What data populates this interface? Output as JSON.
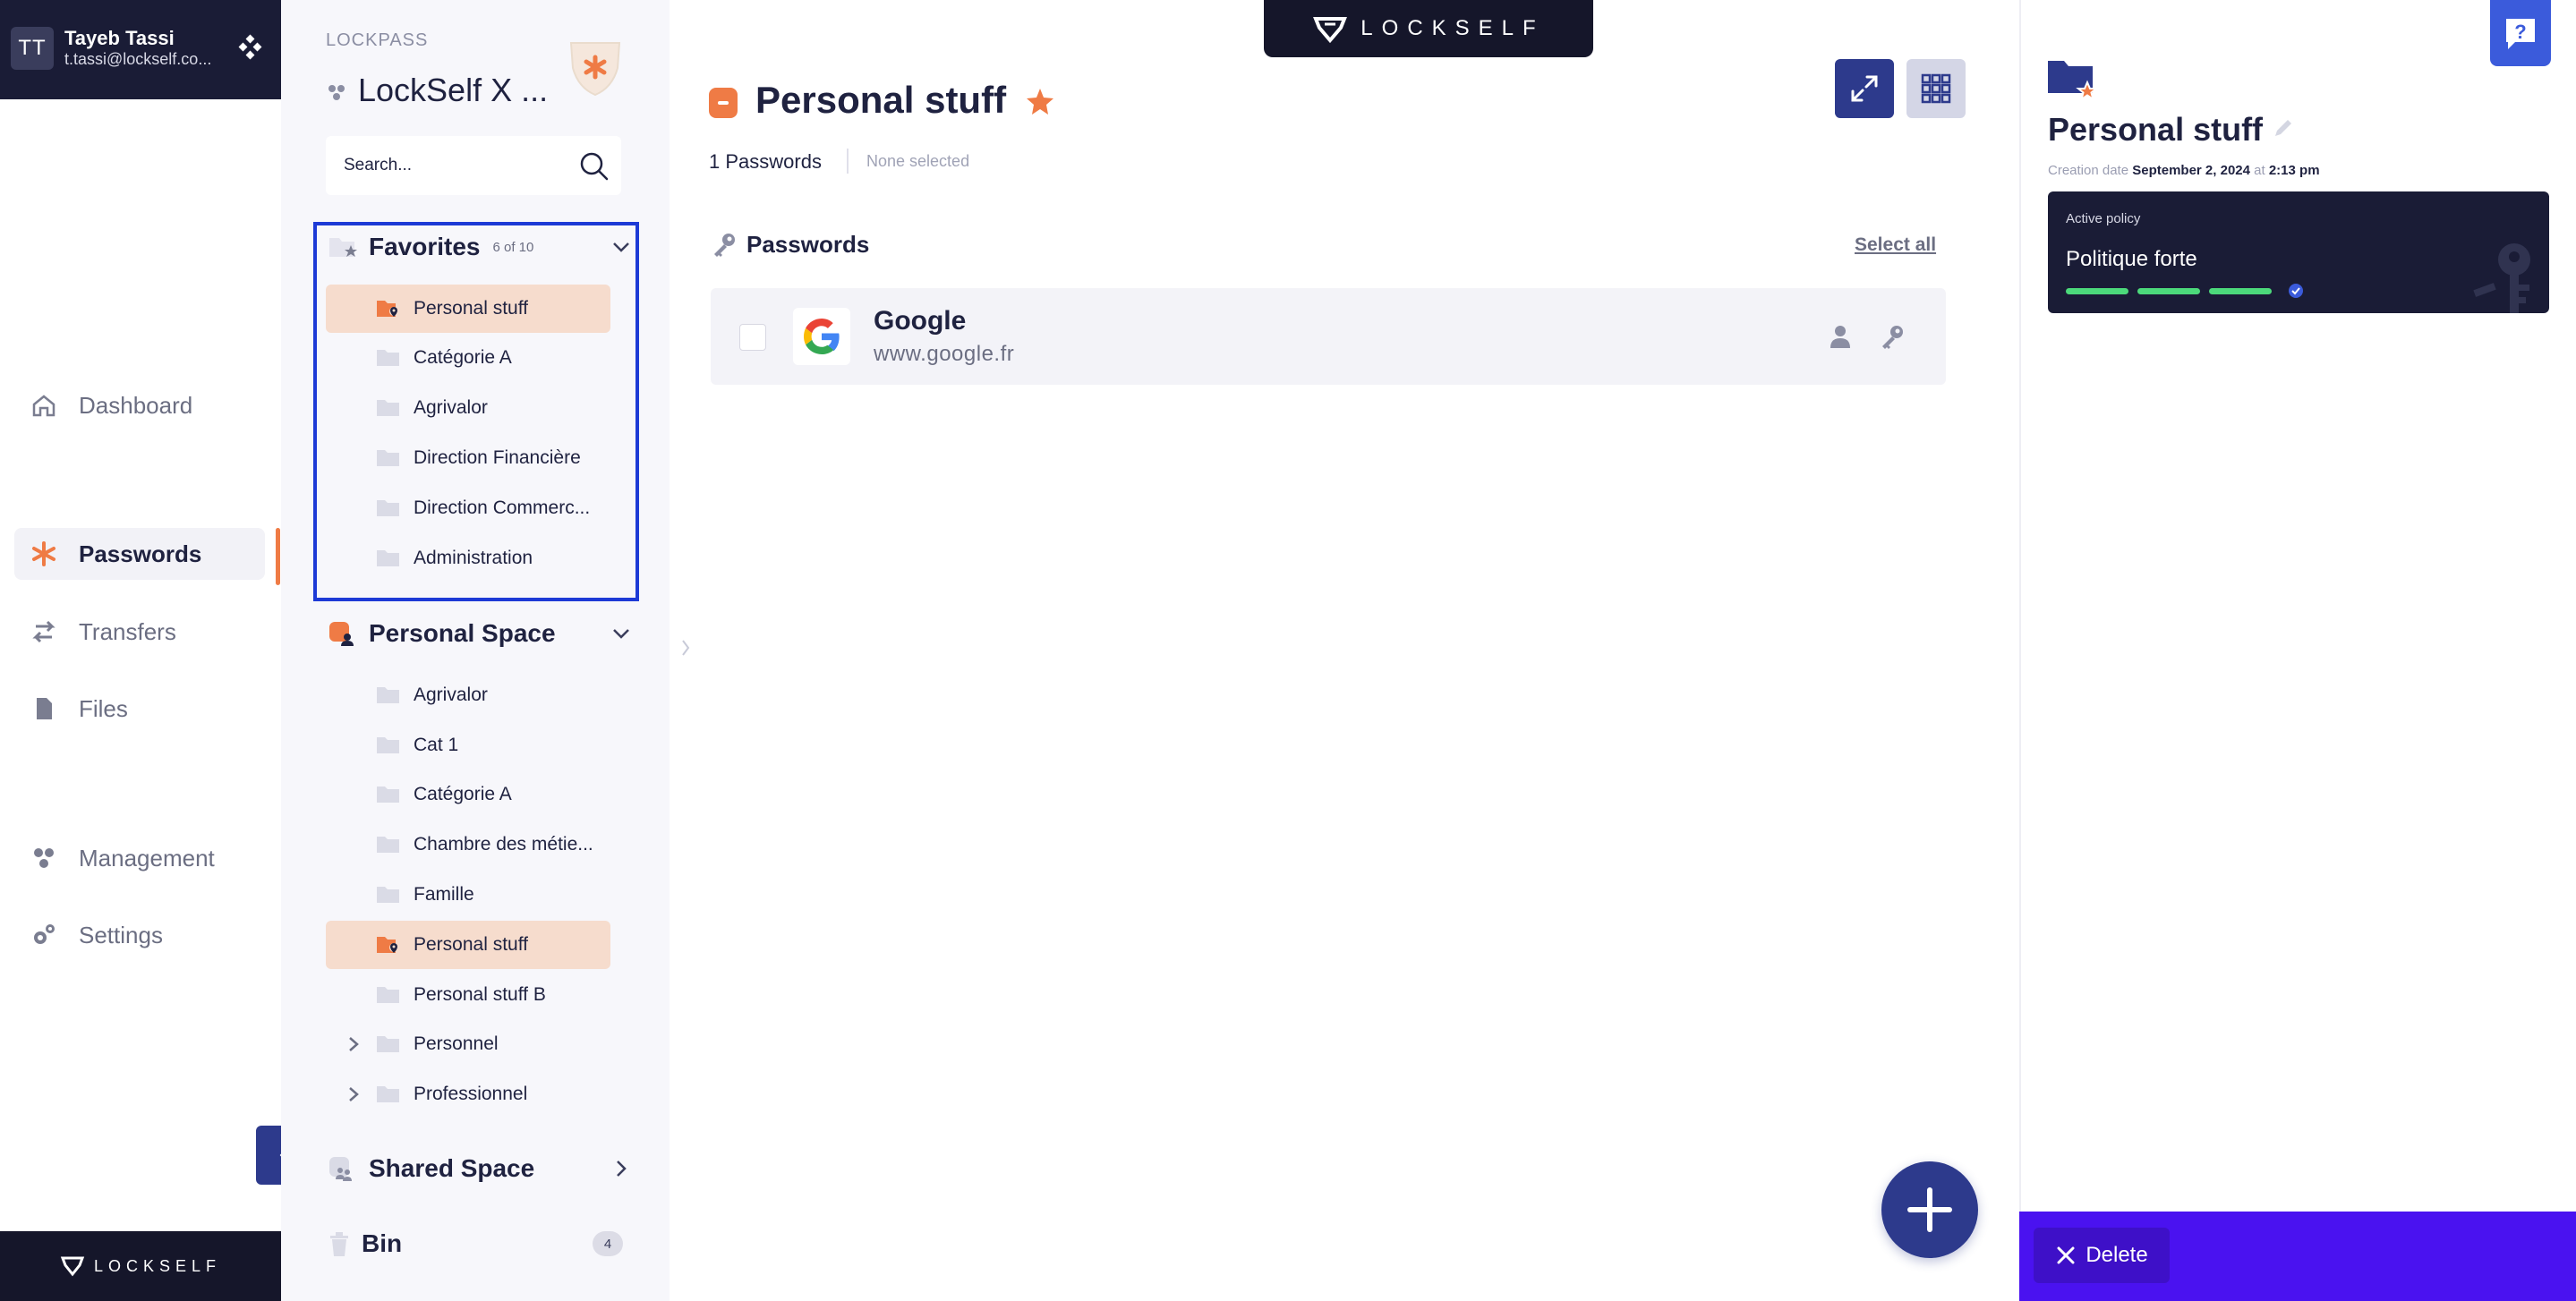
{
  "user": {
    "initials": "TT",
    "name": "Tayeb Tassi",
    "email": "t.tassi@lockself.co..."
  },
  "brand": {
    "wordmark": "LOCKSELF"
  },
  "nav": {
    "items": [
      {
        "label": "Dashboard",
        "icon": "home-icon"
      },
      {
        "label": "Passwords",
        "icon": "asterisk-icon",
        "active": true
      },
      {
        "label": "Transfers",
        "icon": "transfer-icon"
      },
      {
        "label": "Files",
        "icon": "file-icon"
      },
      {
        "label": "Management",
        "icon": "management-icon"
      },
      {
        "label": "Settings",
        "icon": "gear-icon"
      }
    ]
  },
  "folder_panel": {
    "caption": "LOCKPASS",
    "workspace_title": "LockSelf X ...",
    "search_placeholder": "Search...",
    "favorites": {
      "title": "Favorites",
      "count": "6 of 10",
      "items": [
        {
          "label": "Personal stuff",
          "active": true
        },
        {
          "label": "Catégorie A"
        },
        {
          "label": "Agrivalor"
        },
        {
          "label": "Direction Financière"
        },
        {
          "label": "Direction Commerc..."
        },
        {
          "label": "Administration"
        }
      ]
    },
    "personal_space": {
      "title": "Personal Space",
      "items": [
        {
          "label": "Agrivalor"
        },
        {
          "label": "Cat 1"
        },
        {
          "label": "Catégorie A"
        },
        {
          "label": "Chambre des métie..."
        },
        {
          "label": "Famille"
        },
        {
          "label": "Personal stuff",
          "active": true
        },
        {
          "label": "Personal stuff B"
        },
        {
          "label": "Personnel",
          "expandable": true
        },
        {
          "label": "Professionnel",
          "expandable": true
        }
      ]
    },
    "shared_space": {
      "title": "Shared Space"
    },
    "bin": {
      "title": "Bin",
      "count": "4"
    }
  },
  "main": {
    "title": "Personal stuff",
    "pw_count": "1 Passwords",
    "selection": "None selected",
    "section_title": "Passwords",
    "select_all": "Select all",
    "entries": [
      {
        "name": "Google",
        "url": "www.google.fr"
      }
    ]
  },
  "detail": {
    "title": "Personal stuff",
    "creation_label": "Creation date",
    "creation_date": "September 2, 2024",
    "creation_at": "at",
    "creation_time": "2:13 pm",
    "policy_caption": "Active policy",
    "policy_name": "Politique forte",
    "delete_label": "Delete"
  },
  "colors": {
    "accent": "#ef7b45",
    "primary": "#2d3a8c",
    "dark": "#1a1c36",
    "highlight": "#1d3ad6",
    "action_bar": "#4a12f0",
    "policy_bar": "#4cd97b"
  }
}
